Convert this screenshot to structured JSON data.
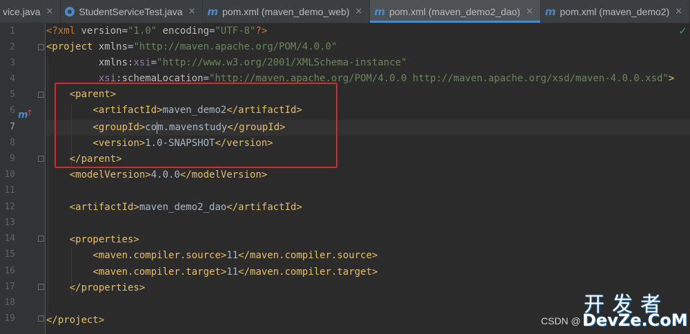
{
  "tabs": [
    {
      "label": "vice.java",
      "icon": "none",
      "active": false
    },
    {
      "label": "StudentServiceTest.java",
      "icon": "class-icon",
      "active": false
    },
    {
      "label": "pom.xml (maven_demo_web)",
      "icon": "maven-icon",
      "active": false
    },
    {
      "label": "pom.xml (maven_demo2_dao)",
      "icon": "maven-icon",
      "active": true
    },
    {
      "label": "pom.xml (maven_demo2)",
      "icon": "maven-icon",
      "active": false
    }
  ],
  "tab_close_glyph": "×",
  "maven_glyph": "m",
  "gutter": {
    "line_numbers": [
      "1",
      "2",
      "3",
      "4",
      "5",
      "6",
      "7",
      "8",
      "9",
      "10",
      "11",
      "12",
      "13",
      "14",
      "15",
      "16",
      "17",
      "18",
      "19"
    ],
    "maven_marker": "m",
    "maven_marker_arrow": "↑"
  },
  "code": {
    "xml_decl_open": "<?xml ",
    "version_attr": "version",
    "version_val": "\"1.0\"",
    "encoding_attr": "encoding",
    "encoding_val": "\"UTF-8\"",
    "xml_decl_close": "?>",
    "project_open": "<project ",
    "xmlns_attr": "xmlns",
    "xmlns_val": "\"http://maven.apache.org/POM/4.0.0\"",
    "xmlns_prefix": "xmlns:",
    "xsi_ns": "xsi",
    "xsi_val": "\"http://www.w3.org/2001/XMLSchema-instance\"",
    "xsi_prefix": "xsi",
    "schema_attr": ":schemaLocation",
    "schema_val": "\"http://maven.apache.org/POM/4.0.0 http://maven.apache.org/xsd/maven-4.0.0.xsd\"",
    "gt": ">",
    "eq": "=",
    "parent_open": "<parent>",
    "artifact_open": "<artifactId>",
    "parent_artifact": "maven_demo2",
    "artifact_close": "</artifactId>",
    "group_open": "<groupId>",
    "group_before_caret": "co",
    "group_after_caret": "m.mavenstudy",
    "group_close": "</groupId>",
    "version_open": "<version>",
    "version_text": "1.0-SNAPSHOT",
    "version_close": "</version>",
    "parent_close": "</parent>",
    "model_open": "<modelVersion>",
    "model_text": "4.0.0",
    "model_close": "</modelVersion>",
    "artifact_text": "maven_demo2_dao",
    "properties_open": "<properties>",
    "source_open": "<maven.compiler.source>",
    "source_text": "11",
    "source_close": "</maven.compiler.source>",
    "target_open": "<maven.compiler.target>",
    "target_text": "11",
    "target_close": "</maven.compiler.target>",
    "properties_close": "</properties>",
    "project_close": "</project>"
  },
  "status": {
    "check_glyph": "✓"
  },
  "watermark": {
    "csdn": "CSDN @",
    "cn": "开发者",
    "site": "DevZe.CoM"
  },
  "colors": {
    "background": "#2b2b2b",
    "tag": "#e8bf6a",
    "attribute_value": "#6a8759",
    "highlight_box": "#e0262b",
    "active_tab_underline": "#4a88c7"
  }
}
